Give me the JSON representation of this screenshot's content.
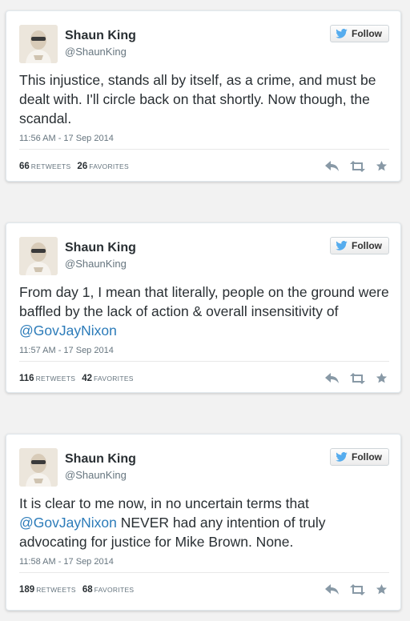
{
  "follow_label": "Follow",
  "icons": {
    "follow": "twitter-bird-icon",
    "reply": "reply-icon",
    "retweet": "retweet-icon",
    "favorite": "star-icon"
  },
  "colors": {
    "link": "#2b7bb9",
    "text": "#292f33",
    "muted": "#66757f",
    "action_icon": "#8899a6",
    "twitter_blue": "#55acee"
  },
  "tweets": [
    {
      "name": "Shaun King",
      "handle": "@ShaunKing",
      "text_before": "This injustice, stands all by itself, as a crime, and must be dealt with. I'll circle back on that shortly. Now though, the scandal.",
      "mention": "",
      "text_after": "",
      "date": "11:56 AM - 17 Sep 2014",
      "retweets": "66",
      "retweets_label": "RETWEETS",
      "favorites": "26",
      "favorites_label": "FAVORITES"
    },
    {
      "name": "Shaun King",
      "handle": "@ShaunKing",
      "text_before": "From day 1, I mean that literally, people on the ground were baffled by the lack of action & overall insensitivity of ",
      "mention": "@GovJayNixon",
      "text_after": "",
      "date": "11:57 AM - 17 Sep 2014",
      "retweets": "116",
      "retweets_label": "RETWEETS",
      "favorites": "42",
      "favorites_label": "FAVORITES"
    },
    {
      "name": "Shaun King",
      "handle": "@ShaunKing",
      "text_before": "It is clear to me now, in no uncertain terms that ",
      "mention": "@GovJayNixon",
      "text_after": " NEVER had any intention of truly advocating for justice for Mike Brown. None.",
      "date": "11:58 AM - 17 Sep 2014",
      "retweets": "189",
      "retweets_label": "RETWEETS",
      "favorites": "68",
      "favorites_label": "FAVORITES"
    }
  ]
}
